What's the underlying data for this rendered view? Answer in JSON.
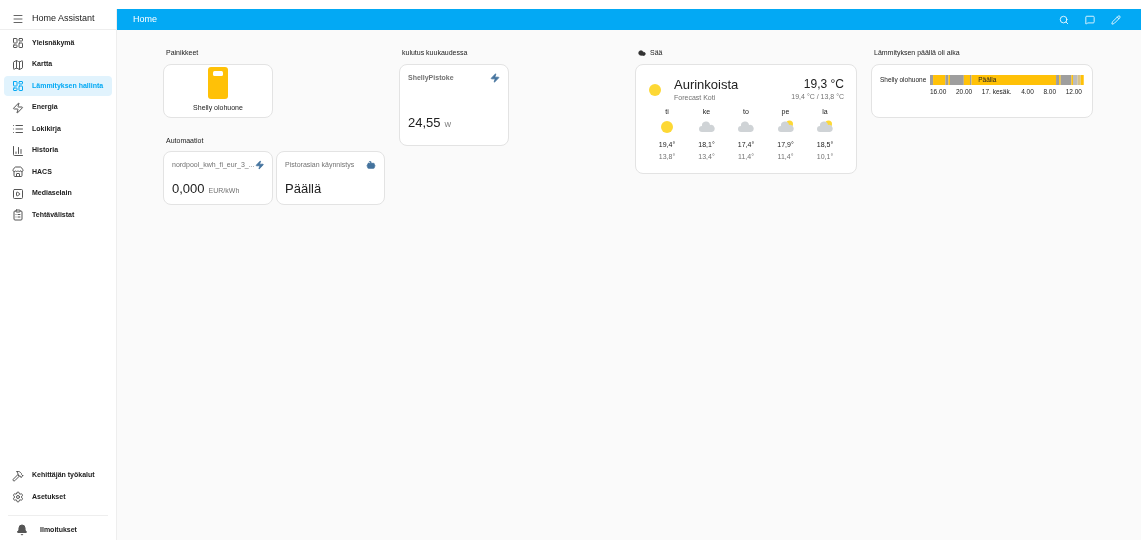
{
  "sidebar": {
    "title": "Home Assistant",
    "items": [
      {
        "label": "Yleisnäkymä",
        "selected": false
      },
      {
        "label": "Kartta",
        "selected": false
      },
      {
        "label": "Lämmityksen hallinta",
        "selected": true
      },
      {
        "label": "Energia",
        "selected": false
      },
      {
        "label": "Lokikirja",
        "selected": false
      },
      {
        "label": "Historia",
        "selected": false
      },
      {
        "label": "HACS",
        "selected": false
      },
      {
        "label": "Mediaselain",
        "selected": false
      },
      {
        "label": "Tehtävälistat",
        "selected": false
      }
    ],
    "bottom_items": [
      {
        "label": "Kehittäjän työkalut",
        "selected": false
      },
      {
        "label": "Asetukset",
        "selected": false
      }
    ],
    "notifications": {
      "label": "Ilmoitukset"
    }
  },
  "header": {
    "title": "Home"
  },
  "columns": [
    {
      "sections": [
        {
          "title": "Painikkeet",
          "cards": [
            {
              "kind": "button",
              "name": "Shelly olohuone"
            }
          ]
        },
        {
          "title": "Automaatiot",
          "cards": [
            {
              "kind": "tile",
              "name": "nordpool_kwh_fi_eur_3_...",
              "value": "0,000",
              "unit": "EUR/kWh"
            },
            {
              "kind": "tile",
              "name": "Pistorasian käynnistys",
              "value": "Päällä"
            }
          ]
        }
      ]
    },
    {
      "sections": [
        {
          "title": "kulutus kuukaudessa",
          "cards": [
            {
              "kind": "sensor",
              "name": "ShellyPistoke",
              "value": "24,55",
              "unit": "W"
            }
          ]
        }
      ]
    },
    {
      "sections": [
        {
          "title": "Sää",
          "cards": [
            {
              "kind": "weather",
              "condition": "Aurinkoista",
              "source": "Forecast Koti",
              "temperature": "19,3 °C",
              "range": "19,4 °C / 13,8 °C",
              "forecast": [
                {
                  "day": "ti",
                  "kind": "sunny",
                  "high": "19,4°",
                  "low": "13,8°"
                },
                {
                  "day": "ke",
                  "kind": "cloudy",
                  "high": "18,1°",
                  "low": "13,4°"
                },
                {
                  "day": "to",
                  "kind": "cloudy",
                  "high": "17,4°",
                  "low": "11,4°"
                },
                {
                  "day": "pe",
                  "kind": "partly",
                  "high": "17,9°",
                  "low": "11,4°"
                },
                {
                  "day": "la",
                  "kind": "partly",
                  "high": "18,5°",
                  "low": "10,1°"
                }
              ]
            }
          ]
        }
      ]
    },
    {
      "sections": [
        {
          "title": "Lämmityksen päällä oli aika",
          "cards": [
            {
              "kind": "timeline",
              "entity": "Shelly olohuone",
              "state_label": "Päälla",
              "ticks": [
                "16.00",
                "20.00",
                "17. kesäk.",
                "4.00",
                "8.00",
                "12.00"
              ]
            }
          ]
        }
      ]
    }
  ]
}
